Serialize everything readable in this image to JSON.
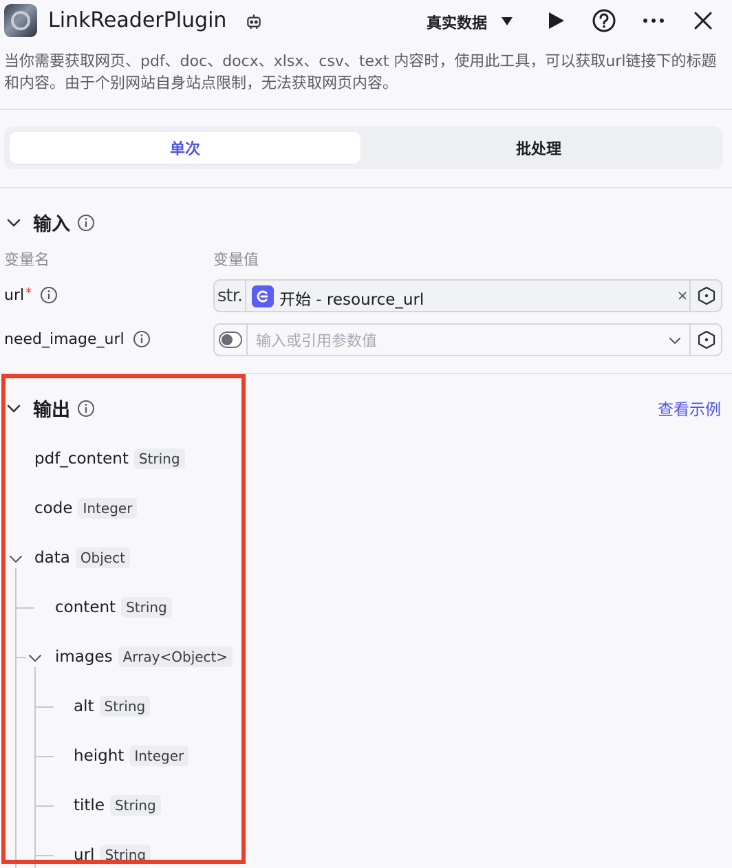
{
  "header": {
    "title": "LinkReaderPlugin",
    "mode": "真实数据",
    "icons": [
      "plugin-logo-icon",
      "robot-icon",
      "caret-down-icon",
      "play-icon",
      "help-icon",
      "more-icon",
      "close-icon"
    ]
  },
  "description": "当你需要获取网页、pdf、doc、docx、xlsx、csv、text 内容时，使用此工具，可以获取url链接下的标题和内容。由于个别网站自身站点限制，无法获取网页内容。",
  "tabs": {
    "single": "单次",
    "batch": "批处理",
    "active": "single"
  },
  "input": {
    "title": "输入",
    "col_name": "变量名",
    "col_value": "变量值",
    "url": {
      "label": "url",
      "required_mark": "*",
      "type_prefix": "str.",
      "ref_text": "开始 - resource_url"
    },
    "need_image_url": {
      "label": "need_image_url",
      "placeholder": "输入或引用参数值"
    }
  },
  "output": {
    "title": "输出",
    "view_example": "查看示例",
    "fields": {
      "pdf_content": {
        "name": "pdf_content",
        "type": "String"
      },
      "code": {
        "name": "code",
        "type": "Integer"
      },
      "data": {
        "name": "data",
        "type": "Object"
      },
      "content": {
        "name": "content",
        "type": "String"
      },
      "images": {
        "name": "images",
        "type": "Array<Object>"
      },
      "alt": {
        "name": "alt",
        "type": "String"
      },
      "height": {
        "name": "height",
        "type": "Integer"
      },
      "title": {
        "name": "title",
        "type": "String"
      },
      "url": {
        "name": "url",
        "type": "String"
      }
    }
  },
  "colors": {
    "accent": "#4d53e8",
    "highlight_border": "#e8402b",
    "required": "#f03a3a"
  }
}
